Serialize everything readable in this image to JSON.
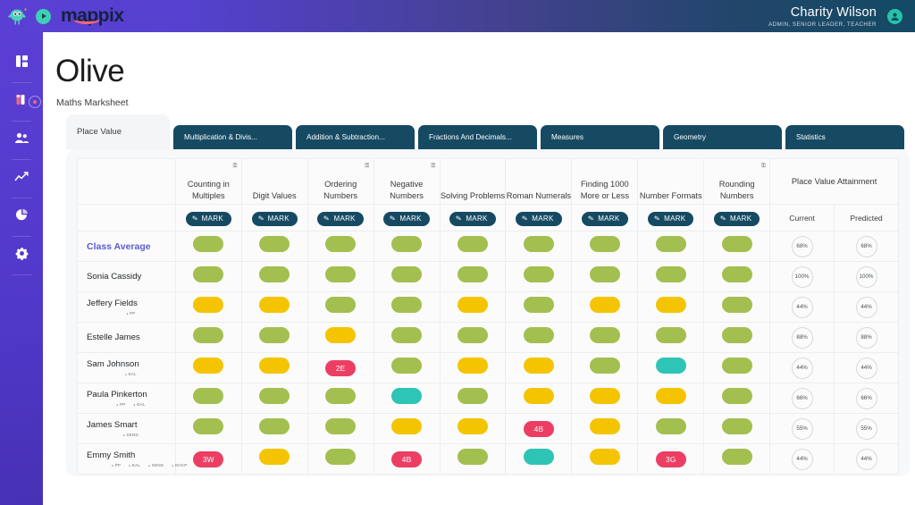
{
  "brand": {
    "wordmark": "mappix",
    "bird_icon": "bird-logo-icon",
    "play_icon": "play-badge-icon"
  },
  "user": {
    "name": "Charity Wilson",
    "roles": "ADMIN, SENIOR LEADER, TEACHER",
    "avatar_icon": "user-avatar-icon"
  },
  "sidebar": {
    "items": [
      {
        "icon": "dashboard-icon"
      },
      {
        "icon": "books-icon",
        "badge": true
      },
      {
        "icon": "people-icon"
      },
      {
        "icon": "trending-chart-icon"
      },
      {
        "icon": "pie-chart-icon"
      },
      {
        "icon": "gear-icon"
      }
    ]
  },
  "page": {
    "title": "Olive",
    "subtitle": "Maths Marksheet"
  },
  "tabs": [
    {
      "label": "Place Value",
      "active": true
    },
    {
      "label": "Multiplication & Divis...",
      "active": false
    },
    {
      "label": "Addition & Subtraction...",
      "active": false
    },
    {
      "label": "Fractions And Decimals...",
      "active": false
    },
    {
      "label": "Measures",
      "active": false
    },
    {
      "label": "Geometry",
      "active": false
    },
    {
      "label": "Statistics",
      "active": false
    }
  ],
  "table": {
    "mark_label": "MARK",
    "pencil_icon": "pencil-icon",
    "lock_icon": "key-lock-icon",
    "attainment_header": "Place Value Attainment",
    "attainment_subheaders": [
      "Current",
      "Predicted"
    ],
    "columns": [
      {
        "label": "Counting in Multiples",
        "locked": true
      },
      {
        "label": "Digit Values",
        "locked": false
      },
      {
        "label": "Ordering Numbers",
        "locked": true
      },
      {
        "label": "Negative Numbers",
        "locked": true
      },
      {
        "label": "Solving Problems",
        "locked": false
      },
      {
        "label": "Roman Numerals",
        "locked": false
      },
      {
        "label": "Finding 1000 More or Less",
        "locked": false
      },
      {
        "label": "Number Formats",
        "locked": false
      },
      {
        "label": "Rounding Numbers",
        "locked": true
      }
    ],
    "rows": [
      {
        "name": "Class Average",
        "is_average": true,
        "tags": [],
        "marks": [
          "green",
          "green",
          "green",
          "green",
          "green",
          "green",
          "green",
          "green",
          "green"
        ],
        "labels": [
          "",
          "",
          "",
          "",
          "",
          "",
          "",
          "",
          ""
        ],
        "current": "68%",
        "predicted": "68%"
      },
      {
        "name": "Sonia Cassidy",
        "is_average": false,
        "tags": [],
        "marks": [
          "green",
          "green",
          "green",
          "green",
          "green",
          "green",
          "green",
          "green",
          "green"
        ],
        "labels": [
          "",
          "",
          "",
          "",
          "",
          "",
          "",
          "",
          ""
        ],
        "current": "100%",
        "predicted": "100%"
      },
      {
        "name": "Jeffery Fields",
        "is_average": false,
        "tags": [
          "PP"
        ],
        "marks": [
          "yellow",
          "yellow",
          "green",
          "green",
          "yellow",
          "green",
          "yellow",
          "yellow",
          "green"
        ],
        "labels": [
          "",
          "",
          "",
          "",
          "",
          "",
          "",
          "",
          ""
        ],
        "current": "44%",
        "predicted": "44%"
      },
      {
        "name": "Estelle James",
        "is_average": false,
        "tags": [],
        "marks": [
          "green",
          "green",
          "yellow",
          "green",
          "green",
          "green",
          "green",
          "green",
          "green"
        ],
        "labels": [
          "",
          "",
          "",
          "",
          "",
          "",
          "",
          "",
          ""
        ],
        "current": "88%",
        "predicted": "88%"
      },
      {
        "name": "Sam Johnson",
        "is_average": false,
        "tags": [
          "EAL"
        ],
        "marks": [
          "yellow",
          "yellow",
          "pink",
          "green",
          "yellow",
          "yellow",
          "green",
          "teal",
          "green"
        ],
        "labels": [
          "",
          "",
          "2E",
          "",
          "",
          "",
          "",
          "",
          ""
        ],
        "current": "44%",
        "predicted": "44%"
      },
      {
        "name": "Paula Pinkerton",
        "is_average": false,
        "tags": [
          "PP",
          "EAL"
        ],
        "marks": [
          "green",
          "green",
          "green",
          "teal",
          "green",
          "yellow",
          "yellow",
          "yellow",
          "green"
        ],
        "labels": [
          "",
          "",
          "",
          "",
          "",
          "",
          "",
          "",
          ""
        ],
        "current": "66%",
        "predicted": "66%"
      },
      {
        "name": "James Smart",
        "is_average": false,
        "tags": [
          "SEND"
        ],
        "marks": [
          "green",
          "green",
          "green",
          "yellow",
          "yellow",
          "pink",
          "yellow",
          "green",
          "green"
        ],
        "labels": [
          "",
          "",
          "",
          "",
          "",
          "4B",
          "",
          "",
          ""
        ],
        "current": "55%",
        "predicted": "55%"
      },
      {
        "name": "Emmy Smith",
        "is_average": false,
        "tags": [
          "PP",
          "EAL",
          "SEND",
          "EHCP"
        ],
        "marks": [
          "pink",
          "yellow",
          "green",
          "pink",
          "green",
          "teal",
          "yellow",
          "pink",
          "green"
        ],
        "labels": [
          "3W",
          "",
          "",
          "4B",
          "",
          "",
          "",
          "3G",
          ""
        ],
        "current": "44%",
        "predicted": "44%"
      }
    ]
  },
  "colors": {
    "green": "#a3bf4f",
    "yellow": "#f5c400",
    "teal": "#2ec4b6",
    "pink": "#ec3e63",
    "brand_purple": "#5b3fd4",
    "brand_navy": "#164a63",
    "accent_pink": "#f2657c",
    "average_text": "#5b5bd6"
  }
}
